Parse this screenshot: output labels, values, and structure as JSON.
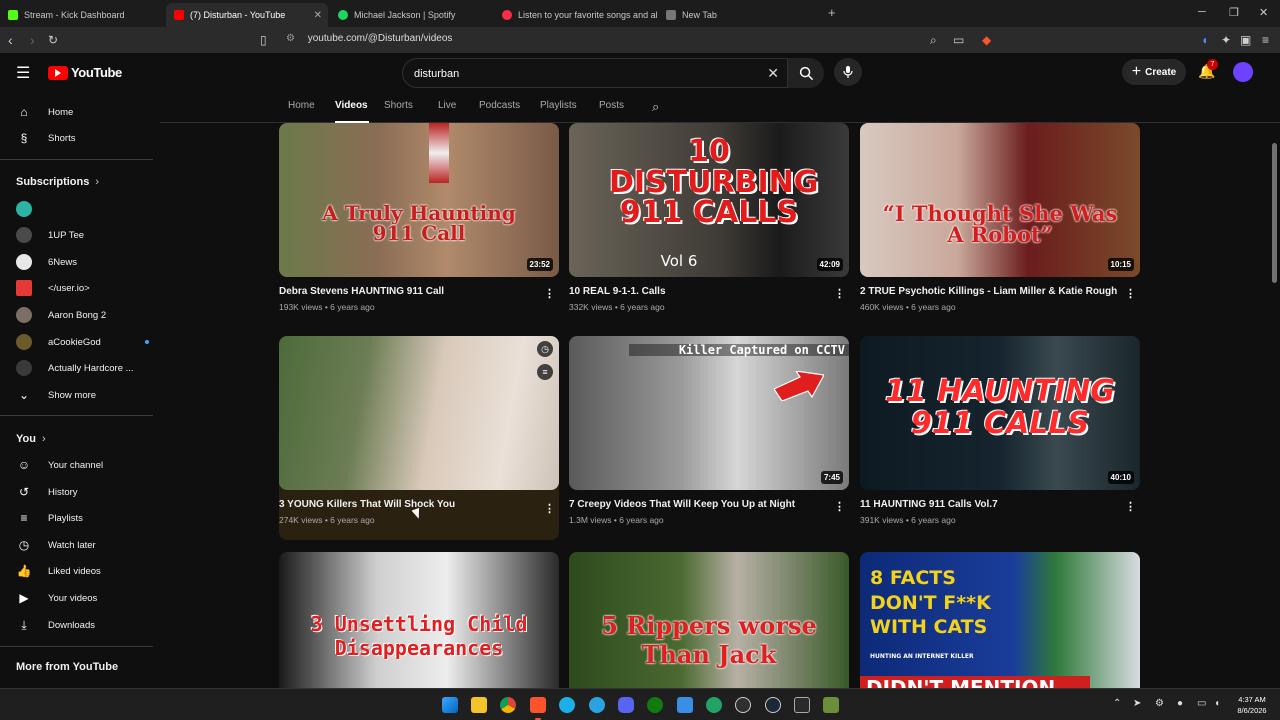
{
  "browser": {
    "tabs": [
      {
        "title": "Stream - Kick Dashboard",
        "color": "#53fc18"
      },
      {
        "title": "(7) Disturban - YouTube",
        "color": "#ff0000"
      },
      {
        "title": "Michael Jackson | Spotify",
        "color": "#1ed760"
      },
      {
        "title": "Listen to your favorite songs and alb",
        "color": "#fa2d48"
      },
      {
        "title": "New Tab",
        "color": "#aaaaaa"
      }
    ],
    "url": "youtube.com/@Disturban/videos"
  },
  "youtube": {
    "logo_text": "YouTube",
    "search_value": "disturban",
    "create_label": "Create",
    "notification_count": "7"
  },
  "sidebar": {
    "top": [
      {
        "label": "Home",
        "icon": "home-icon"
      },
      {
        "label": "Shorts",
        "icon": "shorts-icon"
      }
    ],
    "subscriptions_heading": "Subscriptions",
    "subscriptions": [
      {
        "label": "",
        "color": "#2bb3a3"
      },
      {
        "label": "1UP Tee",
        "color": "#4a4a4a"
      },
      {
        "label": "6News",
        "color": "#e8e8e8"
      },
      {
        "label": "</user.io>",
        "color": "#e53935"
      },
      {
        "label": "Aaron Bong 2",
        "color": "#7a6f66"
      },
      {
        "label": "aCookieGod",
        "color": "#6b5a2a"
      },
      {
        "label": "Actually Hardcore ...",
        "color": "#3a3a3a"
      }
    ],
    "show_more": "Show more",
    "you_heading": "You",
    "you_items": [
      {
        "label": "Your channel",
        "icon": "person-icon"
      },
      {
        "label": "History",
        "icon": "history-icon"
      },
      {
        "label": "Playlists",
        "icon": "playlist-icon"
      },
      {
        "label": "Watch later",
        "icon": "clock-icon"
      },
      {
        "label": "Liked videos",
        "icon": "thumbs-up-icon"
      },
      {
        "label": "Your videos",
        "icon": "video-icon"
      },
      {
        "label": "Downloads",
        "icon": "download-icon"
      }
    ],
    "more_heading": "More from YouTube"
  },
  "channel_tabs": [
    "Home",
    "Videos",
    "Shorts",
    "Live",
    "Podcasts",
    "Playlists",
    "Posts"
  ],
  "videos": [
    {
      "title": "Debra Stevens HAUNTING 911 Call",
      "meta": "193K views • 6 years ago",
      "duration": "23:52",
      "thumb_text": "A Truly Haunting 911 Call"
    },
    {
      "title": "10  REAL 9-1-1. Calls",
      "meta": "332K views • 6 years ago",
      "duration": "42:09",
      "thumb_text": "10 DISTURBING 911 CALLS",
      "thumb_sub": "Vol 6"
    },
    {
      "title": "2 TRUE Psychotic Killings - Liam Miller & Katie Rough",
      "meta": "460K views • 6 years ago",
      "duration": "10:15",
      "thumb_text": "“I Thought She Was A Robot”"
    },
    {
      "title": "3 YOUNG Killers That Will Shock You",
      "meta": "274K views • 6 years ago",
      "duration": "",
      "thumb_text": ""
    },
    {
      "title": "7 Creepy Videos That Will Keep You Up at Night",
      "meta": "1.3M views • 6 years ago",
      "duration": "7:45",
      "thumb_text": "Killer Captured on CCTV"
    },
    {
      "title": "11 HAUNTING 911 Calls Vol.7",
      "meta": "391K views • 6 years ago",
      "duration": "40:10",
      "thumb_text": "11 HAUNTING 911 CALLS"
    },
    {
      "title": "",
      "meta": "",
      "duration": "",
      "thumb_text": "3 Unsettling Child Disappearances"
    },
    {
      "title": "",
      "meta": "",
      "duration": "",
      "thumb_text": "5 Rippers worse Than Jack"
    },
    {
      "title": "",
      "meta": "",
      "duration": "",
      "thumb_text": "8 FACTS DON'T F**K WITH CATS",
      "thumb_sub": "HUNTING AN INTERNET KILLER",
      "thumb_sub2": "DIDN'T MENTION"
    }
  ],
  "taskbar": {
    "time": "4:37 AM",
    "date": "8/6/2026"
  }
}
